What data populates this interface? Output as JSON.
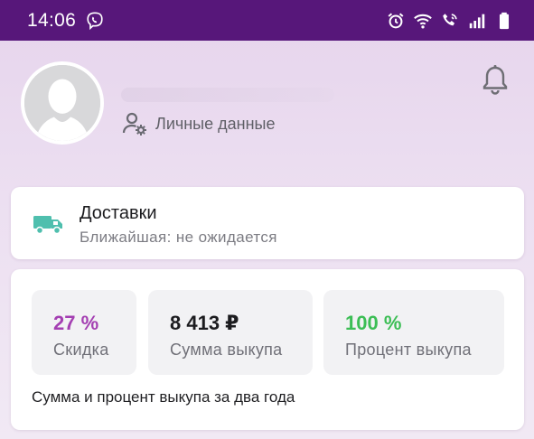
{
  "status_bar": {
    "time": "14:06",
    "icons": [
      "viber-icon",
      "alarm-icon",
      "wifi-icon",
      "call-icon",
      "signal-icon",
      "battery-icon"
    ],
    "background": "#57177a"
  },
  "profile": {
    "personal_data_label": "Личные данные"
  },
  "delivery": {
    "title": "Доставки",
    "subtitle": "Ближайшая: не ожидается",
    "icon_color": "#4fbfae"
  },
  "stats": {
    "tiles": [
      {
        "value": "27 %",
        "label": "Скидка",
        "color": "#a43fb2"
      },
      {
        "value": "8 413 ₽",
        "label": "Сумма выкупа",
        "color": "#1c1c1f"
      },
      {
        "value": "100 %",
        "label": "Процент выкупа",
        "color": "#3cbe55"
      }
    ],
    "note": "Сумма и процент выкупа за два года"
  }
}
